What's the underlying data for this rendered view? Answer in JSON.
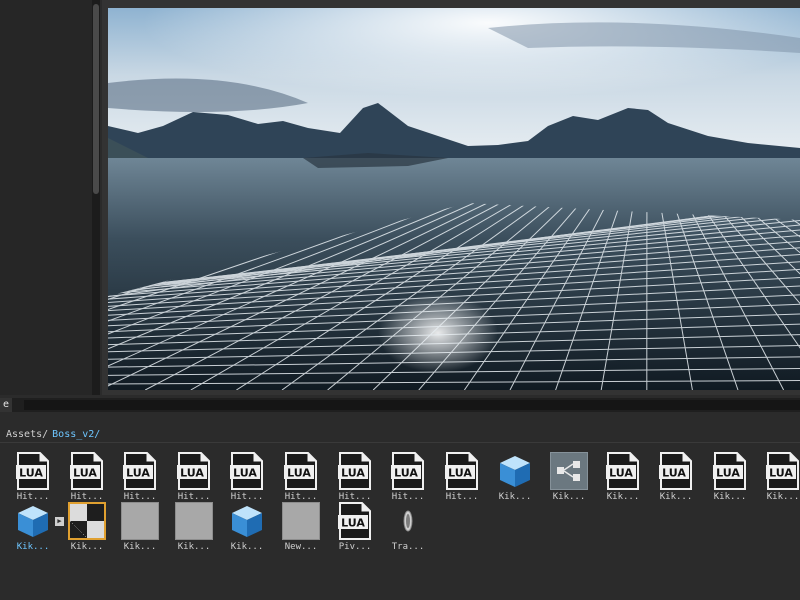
{
  "panel_tab": {
    "label": "e"
  },
  "breadcrumb": {
    "root": "Assets/",
    "current": "Boss_v2/"
  },
  "assets": [
    {
      "label": "Hit...",
      "icon": "lua-script-icon",
      "selected": false
    },
    {
      "label": "Hit...",
      "icon": "lua-script-icon",
      "selected": false
    },
    {
      "label": "Hit...",
      "icon": "lua-script-icon",
      "selected": false
    },
    {
      "label": "Hit...",
      "icon": "lua-script-icon",
      "selected": false
    },
    {
      "label": "Hit...",
      "icon": "lua-script-icon",
      "selected": false
    },
    {
      "label": "Hit...",
      "icon": "lua-script-icon",
      "selected": false
    },
    {
      "label": "Hit...",
      "icon": "lua-script-icon",
      "selected": false
    },
    {
      "label": "Hit...",
      "icon": "lua-script-icon",
      "selected": false
    },
    {
      "label": "Hit...",
      "icon": "lua-script-icon",
      "selected": false
    },
    {
      "label": "Kik...",
      "icon": "cube-model-icon",
      "selected": false
    },
    {
      "label": "Kik...",
      "icon": "node-graph-icon",
      "selected": false
    },
    {
      "label": "Kik...",
      "icon": "lua-script-icon",
      "selected": false
    },
    {
      "label": "Kik...",
      "icon": "lua-script-icon",
      "selected": false
    },
    {
      "label": "Kik...",
      "icon": "lua-script-icon",
      "selected": false
    },
    {
      "label": "Kik...",
      "icon": "lua-script-icon",
      "selected": false
    },
    {
      "label": "Kik...",
      "icon": "cube-model-icon",
      "selected": true
    },
    {
      "label": "Kik...",
      "icon": "checker-texture-icon",
      "selected": false
    },
    {
      "label": "Kik...",
      "icon": "grey-material-icon",
      "selected": false
    },
    {
      "label": "Kik...",
      "icon": "grey-material-icon",
      "selected": false
    },
    {
      "label": "Kik...",
      "icon": "cube-model-icon",
      "selected": false
    },
    {
      "label": "New...",
      "icon": "grey-material-icon",
      "selected": false
    },
    {
      "label": "Piv...",
      "icon": "lua-script-icon",
      "selected": false
    },
    {
      "label": "Tra...",
      "icon": "transform-gizmo-icon",
      "selected": false
    }
  ],
  "icons": {
    "lua_text": "LUA"
  },
  "colors": {
    "selected_label": "#6ec6ff",
    "selection_border": "#e0a030",
    "panel_bg": "#2b2b2b"
  }
}
